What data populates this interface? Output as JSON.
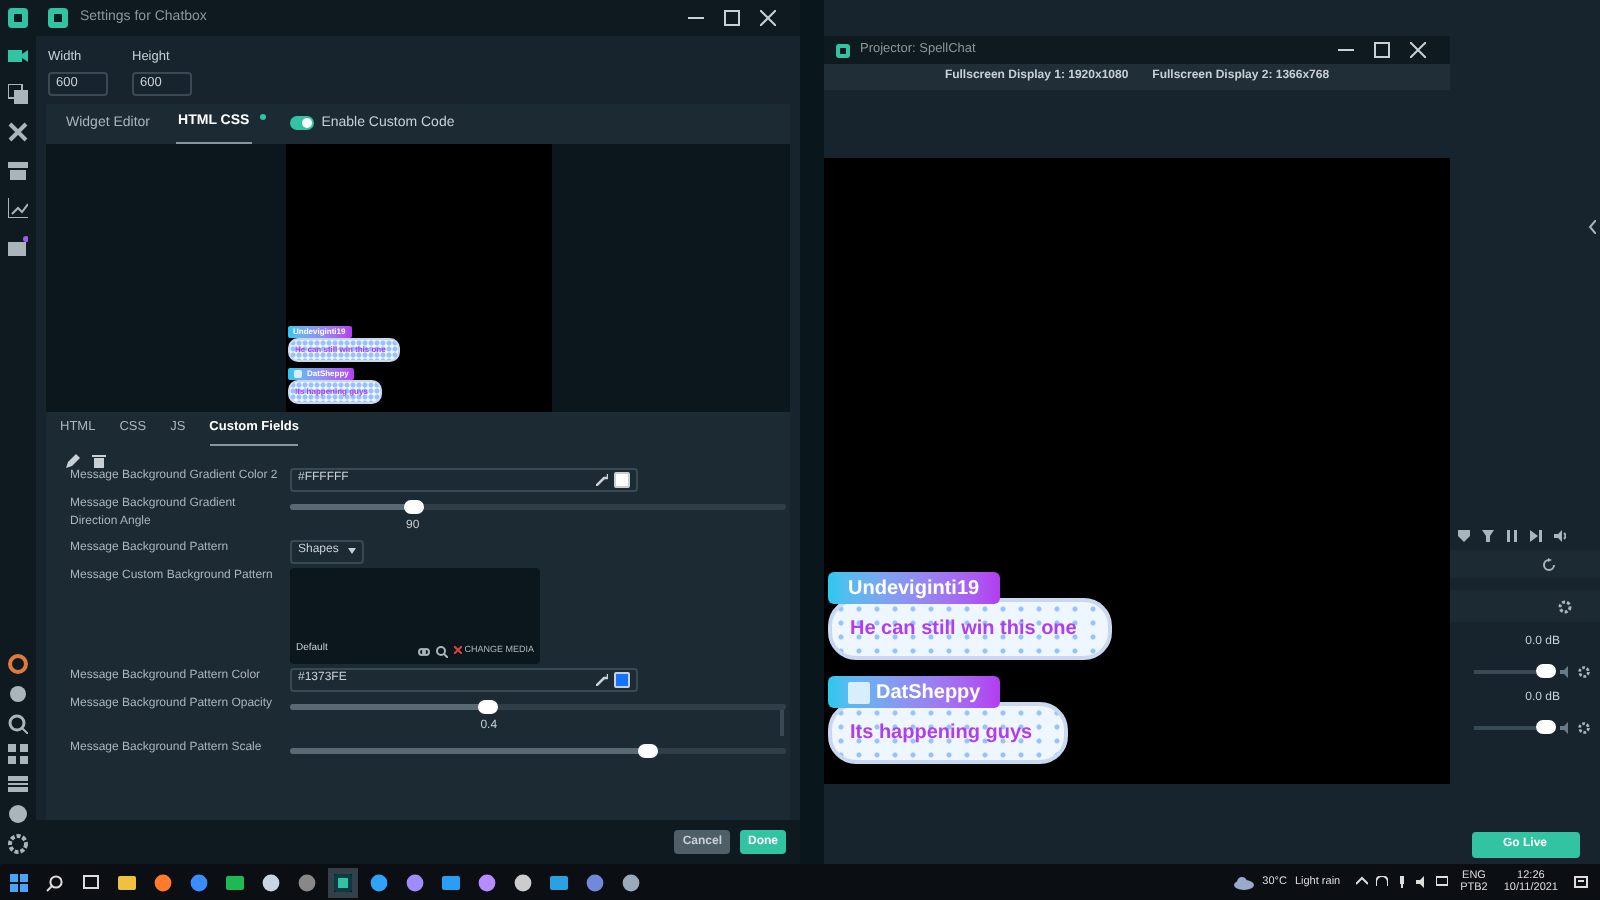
{
  "settings_window": {
    "title": "Settings for Chatbox",
    "size_fields": [
      {
        "label": "Width",
        "value": "600"
      },
      {
        "label": "Height",
        "value": "600"
      }
    ],
    "tabs": [
      {
        "label": "Widget Editor",
        "selected": false
      },
      {
        "label": "HTML CSS",
        "selected": true
      }
    ],
    "custom_code_toggle": {
      "label": "Enable Custom Code",
      "on": true
    },
    "preview_messages": [
      {
        "user": "Undeviginti19",
        "text": "He can still win this one",
        "badge": false
      },
      {
        "user": "DatSheppy",
        "text": "Its happening guys",
        "badge": true
      }
    ],
    "code_tabs": [
      {
        "label": "HTML",
        "selected": false
      },
      {
        "label": "CSS",
        "selected": false
      },
      {
        "label": "JS",
        "selected": false
      },
      {
        "label": "Custom Fields",
        "selected": true
      }
    ],
    "fields": [
      {
        "kind": "color",
        "label": "Message Background Gradient Color 2",
        "value": "#FFFFFF",
        "color": "#ffffff"
      },
      {
        "kind": "slider",
        "label": "Message Background Gradient Direction Angle",
        "level": 0.25,
        "reading": "90"
      },
      {
        "kind": "select",
        "label": "Message Background Pattern",
        "value": "Shapes"
      },
      {
        "kind": "media",
        "label": "Message Custom Background Pattern",
        "caption": "Default",
        "action": "CHANGE MEDIA"
      },
      {
        "kind": "color",
        "label": "Message Background Pattern Color",
        "value": "#1373FE",
        "color": "#1373fe"
      },
      {
        "kind": "slider",
        "label": "Message Background Pattern Opacity",
        "level": 0.4,
        "reading": "0.4"
      },
      {
        "kind": "slider",
        "label": "Message Background Pattern Scale",
        "level": 0.72
      }
    ],
    "buttons": [
      {
        "label": "Cancel",
        "kind": "secondary"
      },
      {
        "label": "Done",
        "kind": "primary"
      }
    ]
  },
  "projector_window": {
    "title": "Projector: SpellChat",
    "displays": [
      "Fullscreen Display 1: 1920x1080",
      "Fullscreen Display 2: 1366x768"
    ],
    "messages": [
      {
        "user": "Undeviginti19",
        "text": "He can still win this one",
        "badge": false
      },
      {
        "user": "DatSheppy",
        "text": "Its happening guys",
        "badge": true
      }
    ]
  },
  "mixer": {
    "channels": [
      {
        "reading": "0.0 dB"
      },
      {
        "reading": "0.0 dB"
      }
    ]
  },
  "go_live_button": "Go Live",
  "taskbar": {
    "temperature": "30°C",
    "weather": "Light rain",
    "language": "ENG",
    "layout": "PTB2",
    "time": "12:26",
    "date": "10/11/2021"
  }
}
